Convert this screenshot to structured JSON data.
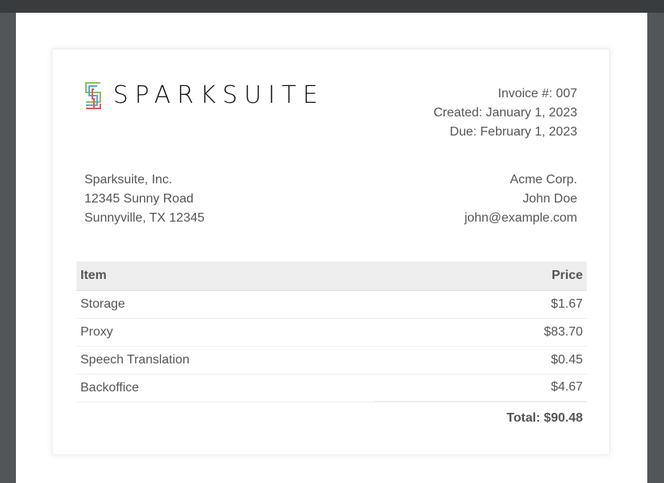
{
  "logo": {
    "text": "SPARKSUITE",
    "colors": [
      "#8dbf5a",
      "#5aa9d6",
      "#e05c5c"
    ]
  },
  "invoice_meta": {
    "number": "Invoice #: 007",
    "created": "Created: January 1, 2023",
    "due": "Due: February 1, 2023"
  },
  "from": {
    "company": "Sparksuite, Inc.",
    "street": "12345 Sunny Road",
    "city": "Sunnyville, TX 12345"
  },
  "to": {
    "company": "Acme Corp.",
    "name": "John Doe",
    "email": "john@example.com"
  },
  "table": {
    "headers": {
      "item": "Item",
      "price": "Price"
    },
    "rows": [
      {
        "item": "Storage",
        "price": "$1.67"
      },
      {
        "item": "Proxy",
        "price": "$83.70"
      },
      {
        "item": "Speech Translation",
        "price": "$0.45"
      },
      {
        "item": "Backoffice",
        "price": "$4.67"
      }
    ],
    "total": "Total: $90.48"
  }
}
